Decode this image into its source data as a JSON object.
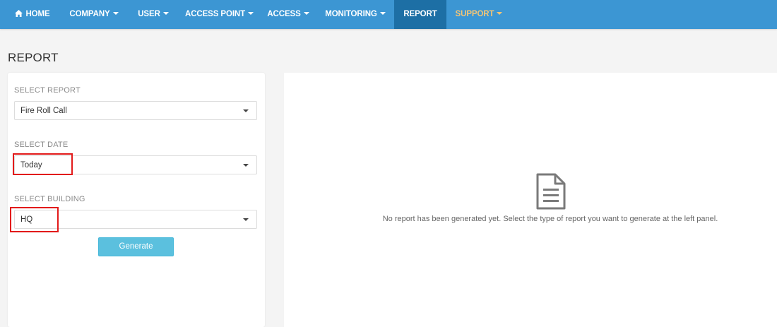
{
  "nav": {
    "home": "HOME",
    "company": "COMPANY",
    "user": "USER",
    "access_point": "ACCESS POINT",
    "access": "ACCESS",
    "monitoring": "MONITORING",
    "report": "REPORT",
    "support": "SUPPORT"
  },
  "page": {
    "title": "REPORT"
  },
  "form": {
    "report_label": "SELECT REPORT",
    "report_value": "Fire Roll Call",
    "date_label": "SELECT DATE",
    "date_value": "Today",
    "building_label": "SELECT BUILDING",
    "building_value": "HQ",
    "generate_label": "Generate"
  },
  "result": {
    "empty_message": "No report has been generated yet. Select the type of report you want to generate at the left panel."
  },
  "colors": {
    "navbar": "#3c96d3",
    "nav_active": "#1d6fa5",
    "support_text": "#f3c576",
    "button": "#5bc0de",
    "highlight": "#e21a1a"
  },
  "icons": {
    "home": "home-icon",
    "caret": "caret-down-icon",
    "document": "document-icon"
  }
}
